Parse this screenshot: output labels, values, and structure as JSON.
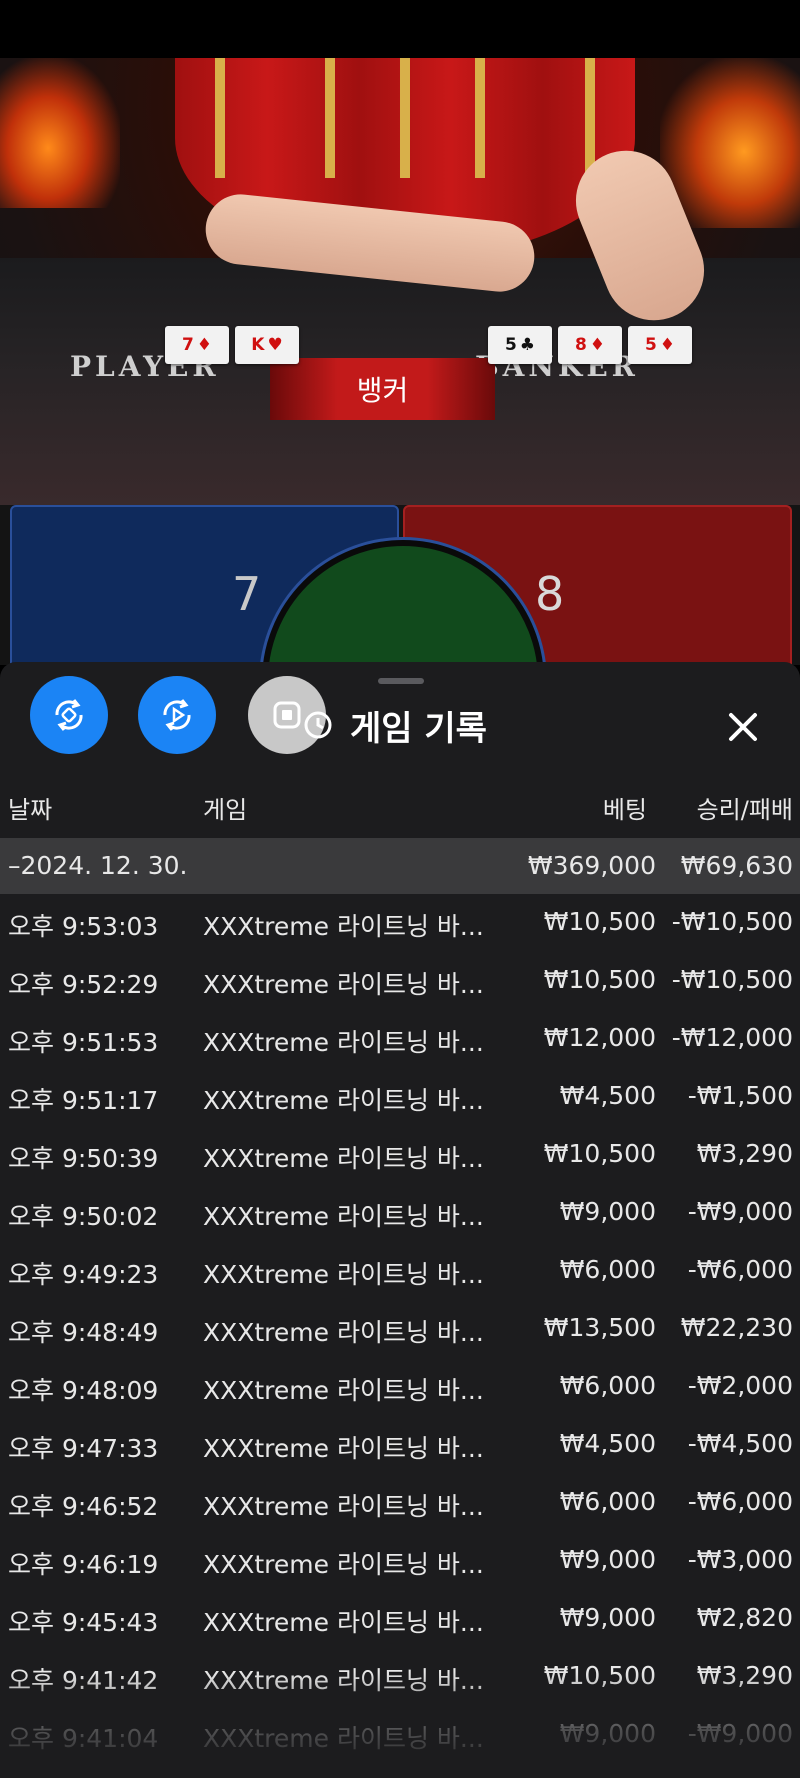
{
  "video": {
    "player_label": "PLAYER",
    "banker_label": "BANKER",
    "result_banner": "뱅커",
    "player_cards": [
      {
        "rank": "7",
        "suit": "♦",
        "red": true
      },
      {
        "rank": "K",
        "suit": "♥",
        "red": true
      }
    ],
    "banker_cards": [
      {
        "rank": "5",
        "suit": "♣",
        "red": false
      },
      {
        "rank": "8",
        "suit": "♦",
        "red": true
      },
      {
        "rank": "5",
        "suit": "♦",
        "red": true
      }
    ]
  },
  "bet_area": {
    "player_score": "7",
    "banker_score": "8"
  },
  "sheet": {
    "title": "게임 기록",
    "buttons": [
      {
        "name": "rotate-camera-button",
        "icon": "rotate-icon",
        "color": "#1b84f5"
      },
      {
        "name": "replay-button",
        "icon": "replay-icon",
        "color": "#1b84f5"
      },
      {
        "name": "stop-record-button",
        "icon": "stop-icon",
        "color": "#c8c8c8"
      }
    ],
    "columns": {
      "date": "날짜",
      "game": "게임",
      "bet": "베팅",
      "win_loss": "승리/패배"
    },
    "summary": {
      "date": "–2024. 12. 30.",
      "bet": "₩369,000",
      "win_loss": "₩69,630"
    },
    "rows": [
      {
        "time": "오후 9:53:03",
        "game": "XXXtreme 라이트닝 바...",
        "bet": "₩10,500",
        "result": "-₩10,500"
      },
      {
        "time": "오후 9:52:29",
        "game": "XXXtreme 라이트닝 바...",
        "bet": "₩10,500",
        "result": "-₩10,500"
      },
      {
        "time": "오후 9:51:53",
        "game": "XXXtreme 라이트닝 바...",
        "bet": "₩12,000",
        "result": "-₩12,000"
      },
      {
        "time": "오후 9:51:17",
        "game": "XXXtreme 라이트닝 바...",
        "bet": "₩4,500",
        "result": "-₩1,500"
      },
      {
        "time": "오후 9:50:39",
        "game": "XXXtreme 라이트닝 바...",
        "bet": "₩10,500",
        "result": "₩3,290"
      },
      {
        "time": "오후 9:50:02",
        "game": "XXXtreme 라이트닝 바...",
        "bet": "₩9,000",
        "result": "-₩9,000"
      },
      {
        "time": "오후 9:49:23",
        "game": "XXXtreme 라이트닝 바...",
        "bet": "₩6,000",
        "result": "-₩6,000"
      },
      {
        "time": "오후 9:48:49",
        "game": "XXXtreme 라이트닝 바...",
        "bet": "₩13,500",
        "result": "₩22,230"
      },
      {
        "time": "오후 9:48:09",
        "game": "XXXtreme 라이트닝 바...",
        "bet": "₩6,000",
        "result": "-₩2,000"
      },
      {
        "time": "오후 9:47:33",
        "game": "XXXtreme 라이트닝 바...",
        "bet": "₩4,500",
        "result": "-₩4,500"
      },
      {
        "time": "오후 9:46:52",
        "game": "XXXtreme 라이트닝 바...",
        "bet": "₩6,000",
        "result": "-₩6,000"
      },
      {
        "time": "오후 9:46:19",
        "game": "XXXtreme 라이트닝 바...",
        "bet": "₩9,000",
        "result": "-₩3,000"
      },
      {
        "time": "오후 9:45:43",
        "game": "XXXtreme 라이트닝 바...",
        "bet": "₩9,000",
        "result": "₩2,820"
      },
      {
        "time": "오후 9:41:42",
        "game": "XXXtreme 라이트닝 바...",
        "bet": "₩10,500",
        "result": "₩3,290"
      },
      {
        "time": "오후 9:41:04",
        "game": "XXXtreme 라이트닝 바...",
        "bet": "₩9,000",
        "result": "-₩9,000"
      }
    ]
  }
}
